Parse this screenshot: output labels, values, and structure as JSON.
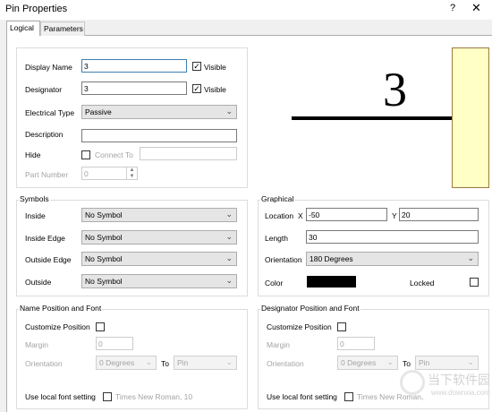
{
  "window": {
    "title": "Pin Properties",
    "help": "?",
    "close": "✕"
  },
  "tabs": [
    {
      "label": "Logical"
    },
    {
      "label": "Parameters"
    }
  ],
  "logical": {
    "display_name": {
      "label": "Display Name",
      "value": "3",
      "visible_label": "Visible",
      "visible_checked": "✓"
    },
    "designator": {
      "label": "Designator",
      "value": "3",
      "visible_label": "Visible",
      "visible_checked": "✓"
    },
    "electrical_type": {
      "label": "Electrical Type",
      "value": "Passive"
    },
    "description": {
      "label": "Description",
      "value": ""
    },
    "hide": {
      "label": "Hide",
      "connect_to_label": "Connect To",
      "connect_to_value": ""
    },
    "part_number": {
      "label": "Part Number",
      "value": "0"
    }
  },
  "preview": {
    "pin_number": "3",
    "body_color": "#ffffc6",
    "pin_color": "#000000"
  },
  "symbols": {
    "title": "Symbols",
    "inside": {
      "label": "Inside",
      "value": "No Symbol"
    },
    "inside_edge": {
      "label": "Inside Edge",
      "value": "No Symbol"
    },
    "outside_edge": {
      "label": "Outside Edge",
      "value": "No Symbol"
    },
    "outside": {
      "label": "Outside",
      "value": "No Symbol"
    }
  },
  "graphical": {
    "title": "Graphical",
    "location_label": "Location",
    "x_label": "X",
    "x_value": "-50",
    "y_label": "Y",
    "y_value": "20",
    "length_label": "Length",
    "length_value": "30",
    "orientation_label": "Orientation",
    "orientation_value": "180 Degrees",
    "color_label": "Color",
    "color_value": "#000000",
    "locked_label": "Locked"
  },
  "name_position": {
    "title": "Name Position and Font",
    "customize_label": "Customize Position",
    "margin_label": "Margin",
    "margin_value": "0",
    "orientation_label": "Orientation",
    "orientation_value": "0 Degrees",
    "to_label": "To",
    "to_value": "Pin",
    "font_label": "Use local font setting",
    "font_value": "Times New Roman, 10"
  },
  "designator_position": {
    "title": "Designator Position and Font",
    "customize_label": "Customize Position",
    "margin_label": "Margin",
    "margin_value": "0",
    "orientation_label": "Orientation",
    "orientation_value": "0 Degrees",
    "to_label": "To",
    "to_value": "Pin",
    "font_label": "Use local font setting",
    "font_value": "Times New Roman,"
  },
  "watermark": {
    "name": "当下软件园",
    "url": "www.downxia.com"
  }
}
